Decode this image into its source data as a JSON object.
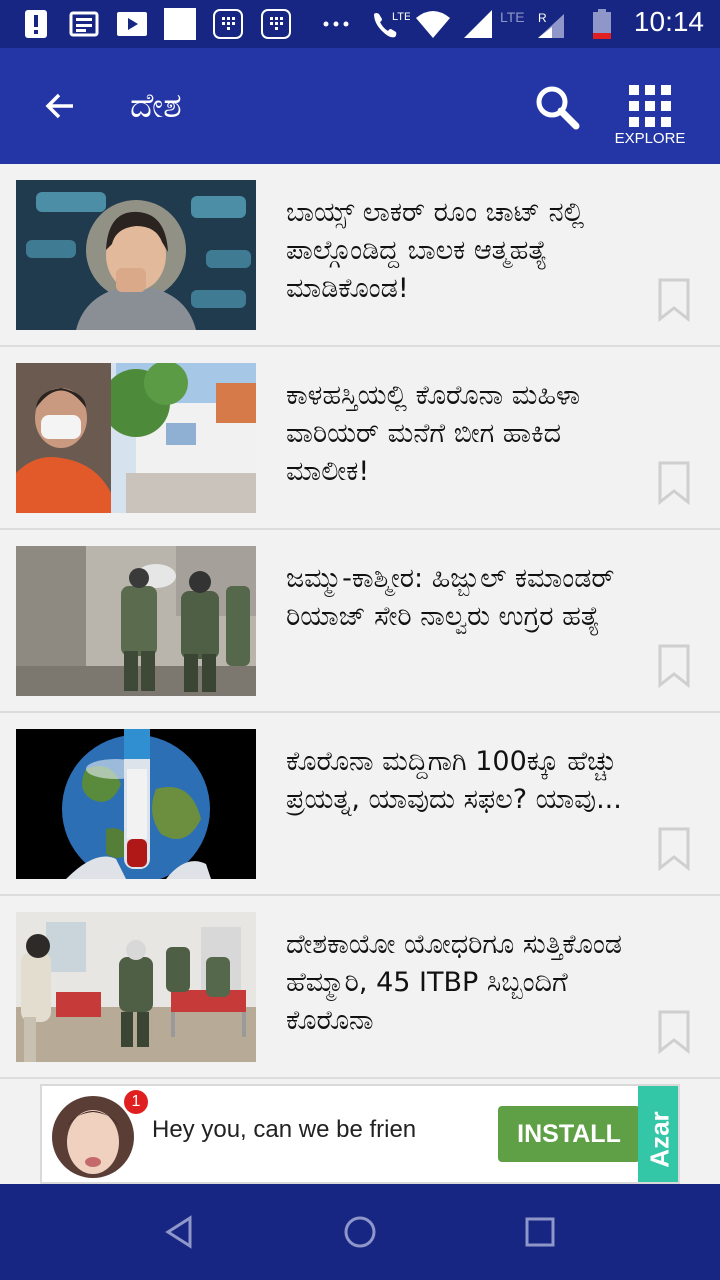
{
  "status_bar": {
    "time": "10:14",
    "lte_label": "LTE",
    "lte2_label": "LTE",
    "roaming_label": "R",
    "icons": [
      "alert-icon",
      "news-icon",
      "video-icon",
      "blank-icon",
      "sim-icon",
      "sim-icon",
      "more-icon",
      "volte-call-icon",
      "wifi-icon",
      "signal-icon",
      "signal-roaming-icon",
      "battery-low-icon"
    ]
  },
  "header": {
    "title": "ದೇಶ",
    "explore_label": "EXPLORE",
    "icons": [
      "back-arrow-icon",
      "search-icon",
      "grid-icon"
    ]
  },
  "articles": [
    {
      "headline": "ಬಾಯ್ಸ್ ಲಾಕರ್ ರೂಂ ಚಾಟ್ ನಲ್ಲಿ ಪಾಲ್ಗೊಂಡಿದ್ದ ಬಾಲಕ ಆತ್ಮಹತ್ಯೆ ಮಾಡಿಕೊಂಡ!"
    },
    {
      "headline": "ಕಾಳಹಸ್ತಿಯಲ್ಲಿ ಕೊರೊನಾ ಮಹಿಳಾ ವಾರಿಯರ್ ಮನೆಗೆ ಬೀಗ ಹಾಕಿದ ಮಾಲೀಕ!"
    },
    {
      "headline": "ಜಮ್ಮು-ಕಾಶ್ಮೀರ: ಹಿಜ್ಬುಲ್ ಕಮಾಂಡರ್ ರಿಯಾಜ್ ಸೇರಿ ನಾಲ್ವರು ಉಗ್ರರ ಹತ್ಯೆ"
    },
    {
      "headline": "ಕೊರೊನಾ ಮದ್ದಿಗಾಗಿ 100ಕ್ಕೂ ಹೆಚ್ಚು ಪ್ರಯತ್ನ, ಯಾವುದು ಸಫಲ? ಯಾವು..."
    },
    {
      "headline": "ದೇಶಕಾಯೋ ಯೋಧರಿಗೂ ಸುತ್ತಿಕೊಂಡ ಹೆಮ್ಮಾರಿ, 45 ITBP ಸಿಬ್ಬಂದಿಗೆ ಕೊರೊನಾ"
    }
  ],
  "ad": {
    "badge": "1",
    "text": "Hey you, can we be frien",
    "install_label": "INSTALL",
    "brand": "Azar"
  },
  "colors": {
    "status_bar": "#172682",
    "app_bar": "#2436a6",
    "install": "#5fa046",
    "brand": "#33c7a7"
  }
}
